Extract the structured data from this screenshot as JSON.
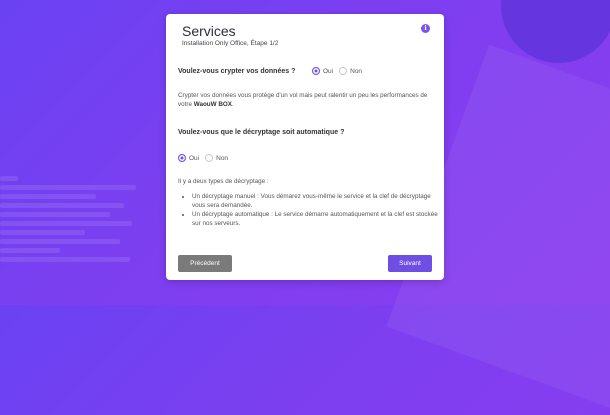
{
  "modal": {
    "title": "Services",
    "subtitle": "Installation Only Office, Étape 1/2",
    "info_icon": "i"
  },
  "question1": {
    "label": "Voulez-vous crypter vos données ?",
    "options": [
      "Oui",
      "Non"
    ],
    "selected": "Oui"
  },
  "info_text": {
    "before": "Crypter vos données vous protège d'un vol mais peut ralentir un peu les performances de votre ",
    "brand": "WaouW BOX",
    "after": "."
  },
  "question2": {
    "label": "Voulez-vous que le décryptage soit automatique ?",
    "options": [
      "Oui",
      "Non"
    ],
    "selected": "Oui"
  },
  "types": {
    "intro": "Il y a deux types de décryptage :",
    "items": [
      "Un décryptage manuel : Vous démarez vous-même le service et la clef de décryptage vous sera demandée.",
      "Un décryptage automatique : Le service démarre automatiquement et la clef est stockée sur nos serveurs."
    ]
  },
  "buttons": {
    "prev": "Précédent",
    "next": "Suivant"
  },
  "colors": {
    "accent": "#6f4ee6",
    "background": "#7a40f0",
    "prev_button": "#7a7a7a"
  }
}
